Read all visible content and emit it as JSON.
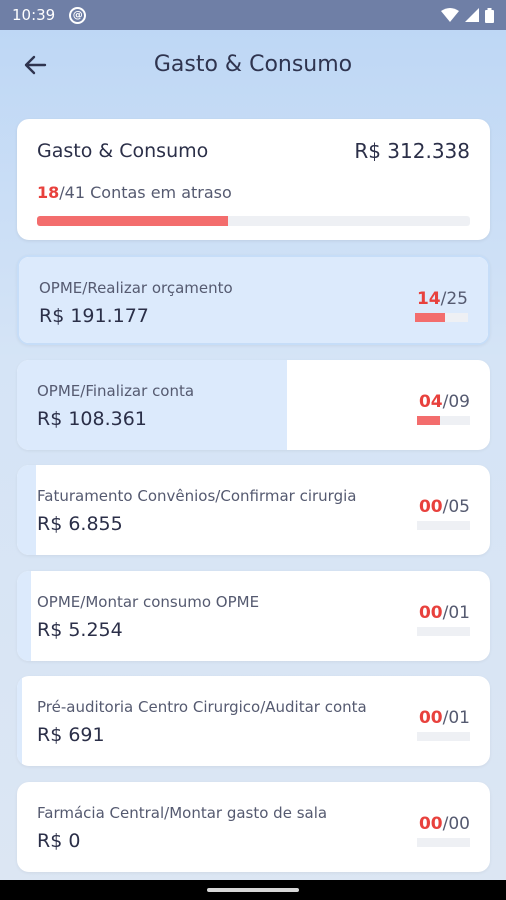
{
  "status_bar": {
    "time": "10:39",
    "icons": [
      "sync-icon",
      "wifi-icon",
      "signal-icon",
      "battery-icon"
    ]
  },
  "header": {
    "title": "Gasto & Consumo",
    "back_icon": "arrow-left-icon"
  },
  "summary": {
    "title": "Gasto & Consumo",
    "total": "R$ 312.338",
    "overdue_count": "18",
    "overdue_total": "/41 Contas em atraso",
    "progress": 0.44
  },
  "items": [
    {
      "name": "OPME/Realizar orçamento",
      "value": "R$ 191.177",
      "count": "14",
      "total": "/25",
      "progress": 0.56,
      "highlight": 1.0
    },
    {
      "name": "OPME/Finalizar conta",
      "value": "R$ 108.361",
      "count": "04",
      "total": "/09",
      "progress": 0.44,
      "highlight": 0.57
    },
    {
      "name": "Faturamento Convênios/Confirmar cirurgia",
      "value": "R$ 6.855",
      "count": "00",
      "total": "/05",
      "progress": 0,
      "highlight": 0.04
    },
    {
      "name": "OPME/Montar consumo OPME",
      "value": "R$ 5.254",
      "count": "00",
      "total": "/01",
      "progress": 0,
      "highlight": 0.03
    },
    {
      "name": "Pré-auditoria Centro Cirurgico/Auditar conta",
      "value": "R$ 691",
      "count": "00",
      "total": "/01",
      "progress": 0,
      "highlight": 0.01
    },
    {
      "name": "Farmácia Central/Montar gasto de sala",
      "value": "R$ 0",
      "count": "00",
      "total": "/00",
      "progress": 0,
      "highlight": 0
    }
  ],
  "colors": {
    "accent_red": "#e8413d",
    "bar_fill": "#f36d6d",
    "highlight": "#dceafc",
    "background_top": "#bcd6f5"
  }
}
